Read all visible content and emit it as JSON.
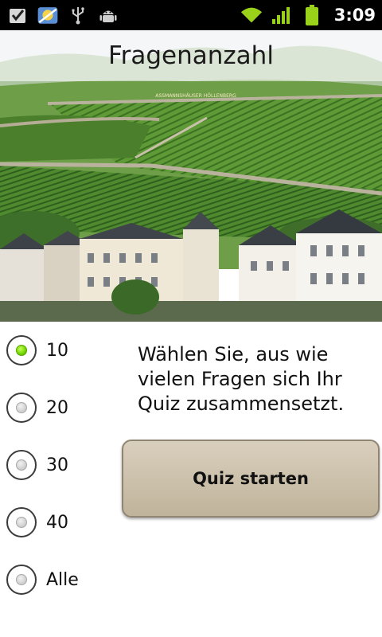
{
  "status_bar": {
    "time": "3:09",
    "icons_left": [
      "checkbox-notification-icon",
      "app-notification-icon",
      "usb-icon",
      "android-debug-icon"
    ],
    "icons_right": [
      "wifi-icon",
      "signal-icon",
      "battery-icon"
    ]
  },
  "header": {
    "title": "Fragenanzahl",
    "image": "vineyard-town-photo",
    "sign_text": "ASSMANNSHÄUSER HÖLLENBERG"
  },
  "question_count": {
    "options": [
      {
        "label": "10",
        "checked": true
      },
      {
        "label": "20",
        "checked": false
      },
      {
        "label": "30",
        "checked": false
      },
      {
        "label": "40",
        "checked": false
      },
      {
        "label": "Alle",
        "checked": false
      }
    ]
  },
  "instruction": "Wählen Sie, aus wie vielen Fragen sich Ihr Quiz zusammensetzt.",
  "start_button_label": "Quiz starten",
  "colors": {
    "status_bar": "#000000",
    "radio_checked": "#6fd400",
    "button_fill": "#cbc0aa",
    "button_border": "#8f8572",
    "battery": "#9ad21a"
  }
}
